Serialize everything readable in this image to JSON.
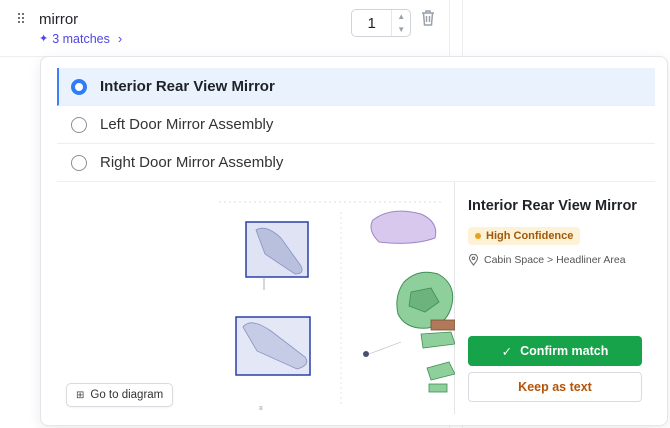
{
  "item": {
    "name": "mirror",
    "matches_label": "3 matches",
    "quantity": "1"
  },
  "options": [
    {
      "label": "Interior Rear View Mirror",
      "selected": true
    },
    {
      "label": "Left Door Mirror Assembly",
      "selected": false
    },
    {
      "label": "Right Door Mirror Assembly",
      "selected": false
    }
  ],
  "detail": {
    "title": "Interior Rear View Mirror",
    "confidence": "High Confidence",
    "location": "Cabin Space > Headliner Area",
    "confirm_label": "Confirm match",
    "keep_label": "Keep as text",
    "goto_label": "Go to diagram"
  },
  "colors": {
    "accent": "#2f7df6",
    "confirm": "#16a34a",
    "matches": "#4f46e5",
    "badge_bg": "#fdf1d6",
    "badge_text": "#a0590b"
  },
  "icons": {
    "drag": "drag-handle-icon",
    "sparkle": "sparkle-icon",
    "chevron": "chevron-right-icon",
    "trash": "trash-icon",
    "location": "location-pin-icon",
    "check": "check-icon",
    "grid": "grid-icon"
  }
}
